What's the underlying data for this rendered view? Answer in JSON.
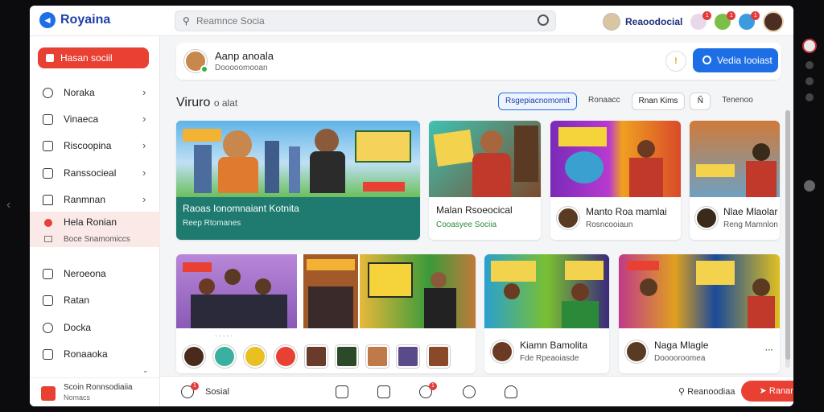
{
  "app": {
    "name": "Royaina",
    "logo_icon": "back-arrow-icon"
  },
  "search": {
    "placeholder": "Reamnce Socia"
  },
  "header": {
    "account_name": "Reaoodocial",
    "notification_counts": [
      "1",
      "1",
      "1"
    ]
  },
  "sidebar": {
    "primary_label": "Hasan sociil",
    "items": [
      {
        "label": "Noraka",
        "icon": "circle-icon"
      },
      {
        "label": "Vinaeca",
        "icon": "square-icon"
      },
      {
        "label": "Riscoopina",
        "icon": "square-icon"
      },
      {
        "label": "Ranssocieal",
        "icon": "square-icon"
      },
      {
        "label": "Ranmnan",
        "icon": "house-icon"
      }
    ],
    "active_item": {
      "label": "Hela Ronian",
      "sub": "Boce Snamomiccs"
    },
    "lower_items": [
      {
        "label": "Neroeona"
      },
      {
        "label": "Ratan"
      },
      {
        "label": "Docka"
      },
      {
        "label": "Ronaaoka"
      }
    ],
    "footer": {
      "title": "Scoin Ronnsodiaiia",
      "subtitle": "Nomacs"
    }
  },
  "profile": {
    "name": "Aanp anoala",
    "subtitle": "Dooooomooan",
    "button_label": "Vedia Iooiast",
    "bell_glyph": "!"
  },
  "section": {
    "title": "Viruro",
    "title_suffix": "o alat"
  },
  "filters": [
    {
      "label": "Rsgepiacnomomit",
      "selected": true
    },
    {
      "label": "Ronaacc",
      "selected": false,
      "plain": true
    },
    {
      "label": "Rnan Kims",
      "selected": false
    },
    {
      "label": "Ñ",
      "icon": true
    },
    {
      "label": "Tenenoo",
      "selected": false,
      "plain": true
    }
  ],
  "cards_row1": [
    {
      "title": "Raoas Ionomnaiant Kotnita",
      "sub": "Reep Rtomanes"
    },
    {
      "title": "Malan Rsoeocical",
      "sub": "Cooasyee Sociia"
    },
    {
      "title": "Manto Roa mamlai",
      "sub": "Rosncooiaun"
    },
    {
      "title": "Nlae Mlaolar",
      "sub": "Reng Mamnlon"
    }
  ],
  "cards_row2": [
    {
      "title": "Kiamn Bamolita",
      "sub": "Fde Rpeaoiasde"
    },
    {
      "title": "Naga Mlagle",
      "sub": "Dooooroomea"
    }
  ],
  "bottombar": {
    "social_label": "Sosial",
    "search_label": "Reanoodiaa",
    "cta_label": "Ranan",
    "badge": "1"
  },
  "colors": {
    "accent_blue": "#1e6fe6",
    "accent_red": "#e94034",
    "chat_green": "#2fb34a"
  }
}
